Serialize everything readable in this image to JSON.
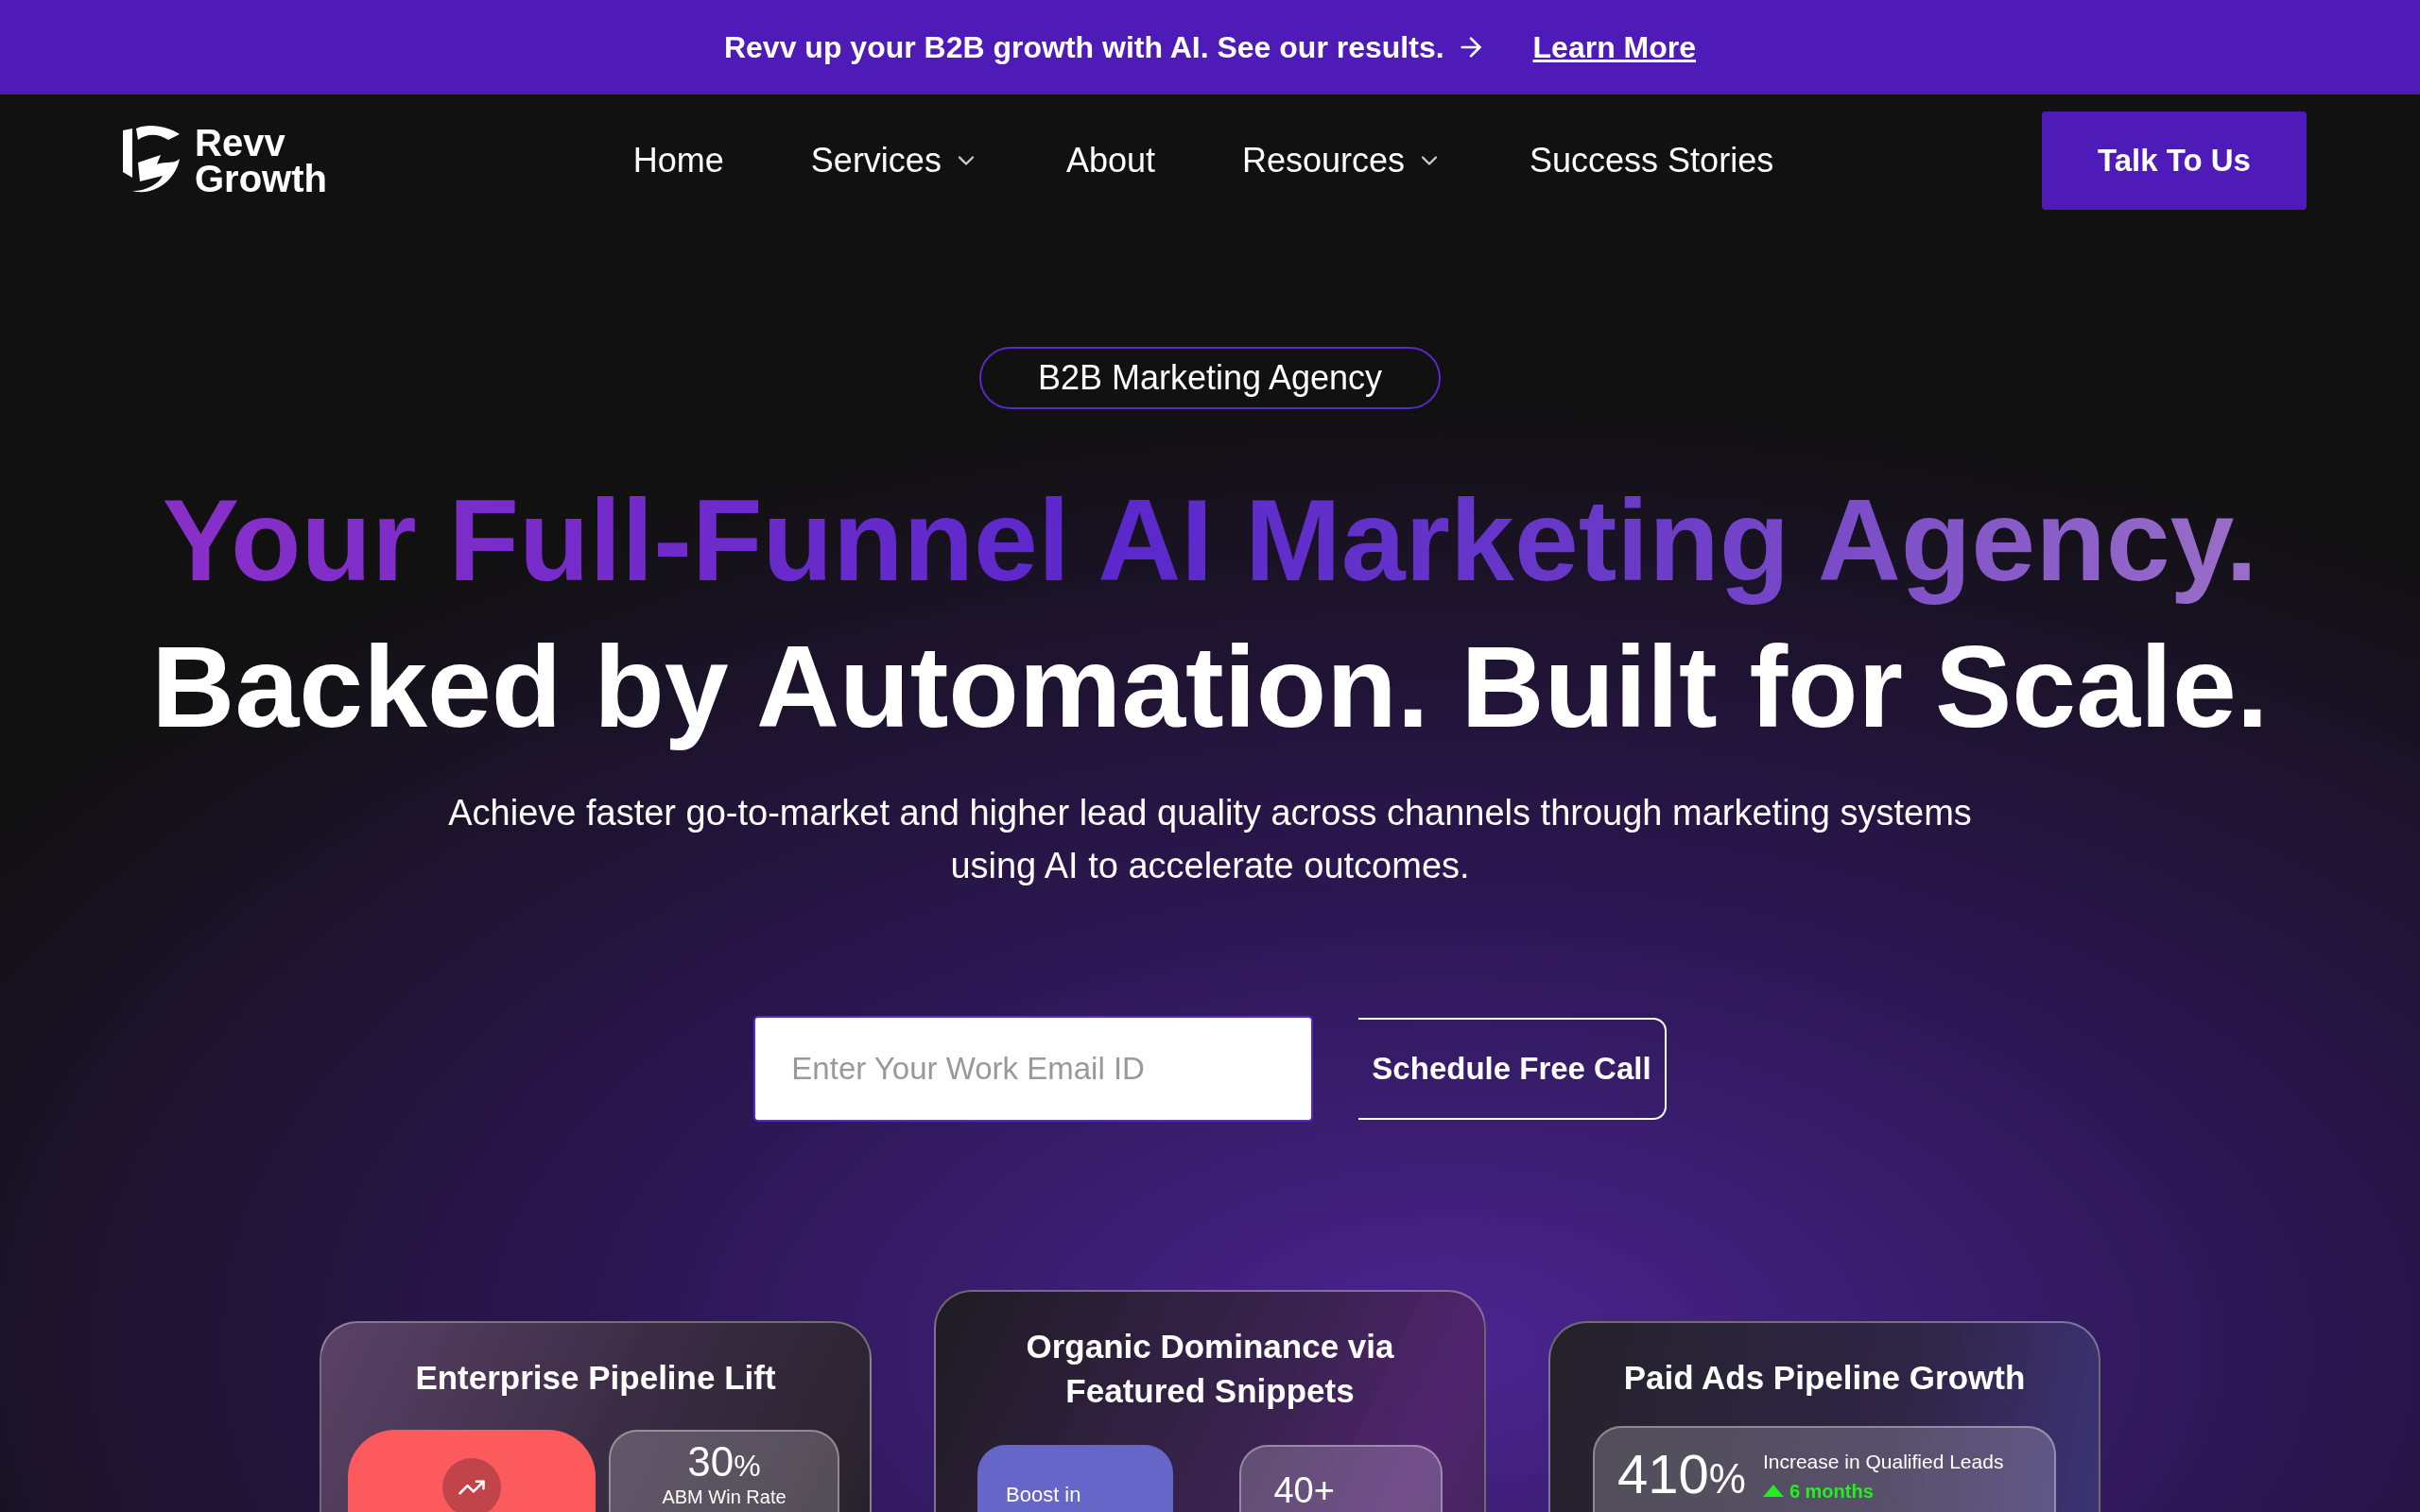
{
  "announcement": {
    "text": "Revv up your B2B growth with AI. See our results.",
    "link": "Learn More"
  },
  "logo": {
    "line1": "Revv",
    "line2": "Growth"
  },
  "nav": [
    {
      "label": "Home",
      "dropdown": false
    },
    {
      "label": "Services",
      "dropdown": true
    },
    {
      "label": "About",
      "dropdown": false
    },
    {
      "label": "Resources",
      "dropdown": true
    },
    {
      "label": "Success Stories",
      "dropdown": false
    }
  ],
  "cta": "Talk To Us",
  "badge": "B2B Marketing Agency",
  "headline": {
    "line1": "Your Full-Funnel AI Marketing Agency.",
    "line2": "Backed by Automation. Built for Scale."
  },
  "subtitle": "Achieve faster go-to-market and higher lead quality across channels through marketing systems using AI to accelerate outcomes.",
  "form": {
    "placeholder": "Enter Your Work Email ID",
    "button": "Schedule Free Call"
  },
  "cards": [
    {
      "title": "Enterprise Pipeline Lift",
      "stat": "30",
      "unit": "%",
      "stat_label": "ABM Win Rate"
    },
    {
      "title": "Organic Dominance via Featured Snippets",
      "tile_label": "Boost in",
      "stat": "40+"
    },
    {
      "title": "Paid Ads Pipeline Growth",
      "stat": "410",
      "unit": "%",
      "stat_label": "Increase in Qualified Leads",
      "trend": "6 months"
    }
  ]
}
